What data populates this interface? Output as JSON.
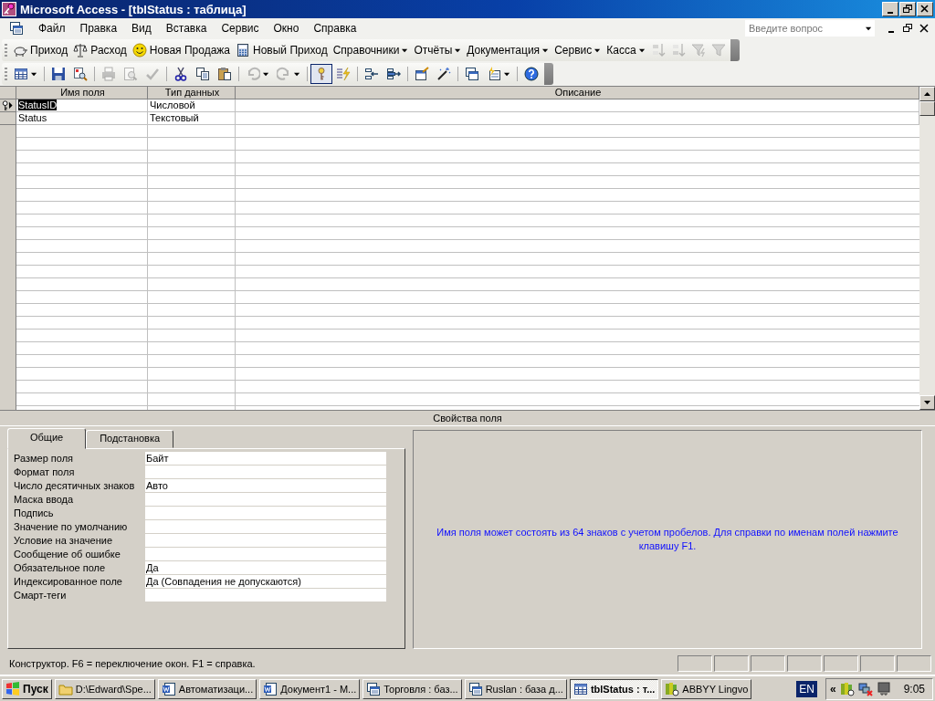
{
  "window": {
    "title": "Microsoft Access - [tblStatus : таблица]"
  },
  "menu": [
    {
      "label": "Файл"
    },
    {
      "label": "Правка"
    },
    {
      "label": "Вид"
    },
    {
      "label": "Вставка"
    },
    {
      "label": "Сервис"
    },
    {
      "label": "Окно"
    },
    {
      "label": "Справка"
    }
  ],
  "help_search": {
    "placeholder": "Введите вопрос"
  },
  "custom_toolbar": [
    {
      "kind": "piggy",
      "label": "Приход",
      "disabled": false
    },
    {
      "kind": "scales",
      "label": "Расход",
      "disabled": false
    },
    {
      "kind": "smiley",
      "label": "Новая Продажа",
      "disabled": false
    },
    {
      "kind": "calculator",
      "label": "Новый Приход",
      "disabled": false
    },
    {
      "kind": "menu",
      "label": "Справочники",
      "disabled": false
    },
    {
      "kind": "menu",
      "label": "Отчёты",
      "disabled": false
    },
    {
      "kind": "menu",
      "label": "Документация",
      "disabled": false
    },
    {
      "kind": "menu",
      "label": "Сервис",
      "disabled": false
    },
    {
      "kind": "menu",
      "label": "Касса",
      "disabled": false
    },
    {
      "kind": "sort_asc",
      "disabled": true
    },
    {
      "kind": "sort_desc",
      "disabled": true
    },
    {
      "kind": "filter_selection",
      "disabled": true
    },
    {
      "kind": "filter",
      "disabled": true
    }
  ],
  "design_toolbar": [
    {
      "kind": "table",
      "dropdown": true,
      "disabled": false,
      "pressed": false
    },
    {
      "kind": "separator"
    },
    {
      "kind": "save",
      "dropdown": false,
      "disabled": false,
      "pressed": false
    },
    {
      "kind": "search_doc",
      "dropdown": false,
      "disabled": false,
      "pressed": false
    },
    {
      "kind": "separator"
    },
    {
      "kind": "print",
      "dropdown": false,
      "disabled": true,
      "pressed": false
    },
    {
      "kind": "preview",
      "dropdown": false,
      "disabled": true,
      "pressed": false
    },
    {
      "kind": "spell",
      "dropdown": false,
      "disabled": true,
      "pressed": false
    },
    {
      "kind": "separator"
    },
    {
      "kind": "cut",
      "dropdown": false,
      "disabled": false,
      "pressed": false
    },
    {
      "kind": "copy",
      "dropdown": false,
      "disabled": false,
      "pressed": false
    },
    {
      "kind": "paste",
      "dropdown": false,
      "disabled": false,
      "pressed": false
    },
    {
      "kind": "separator"
    },
    {
      "kind": "undo",
      "dropdown": true,
      "disabled": true,
      "pressed": false
    },
    {
      "kind": "redo",
      "dropdown": true,
      "disabled": true,
      "pressed": false
    },
    {
      "kind": "separator"
    },
    {
      "kind": "key",
      "dropdown": false,
      "disabled": false,
      "pressed": true
    },
    {
      "kind": "build",
      "dropdown": false,
      "disabled": false,
      "pressed": false
    },
    {
      "kind": "separator"
    },
    {
      "kind": "insert_rows",
      "dropdown": false,
      "disabled": false,
      "pressed": false
    },
    {
      "kind": "delete_rows",
      "dropdown": false,
      "disabled": false,
      "pressed": false
    },
    {
      "kind": "separator"
    },
    {
      "kind": "properties",
      "dropdown": false,
      "disabled": false,
      "pressed": false
    },
    {
      "kind": "builder",
      "dropdown": false,
      "disabled": false,
      "pressed": false
    },
    {
      "kind": "separator"
    },
    {
      "kind": "db_window",
      "dropdown": false,
      "disabled": false,
      "pressed": false
    },
    {
      "kind": "new_object",
      "dropdown": true,
      "disabled": false,
      "pressed": false
    },
    {
      "kind": "separator"
    },
    {
      "kind": "help",
      "dropdown": false,
      "disabled": false,
      "pressed": false
    }
  ],
  "table": {
    "columns": [
      "Имя поля",
      "Тип данных",
      "Описание"
    ],
    "rows": [
      {
        "name": "StatusID",
        "type": "Числовой",
        "selected": true,
        "primary_key": true,
        "current": true
      },
      {
        "name": "Status",
        "type": "Текстовый",
        "selected": false,
        "primary_key": false,
        "current": false
      }
    ]
  },
  "properties": {
    "title": "Свойства поля",
    "tabs": [
      {
        "label": "Общие",
        "selected": true
      },
      {
        "label": "Подстановка",
        "selected": false
      }
    ],
    "items": [
      {
        "label": "Размер поля",
        "value": "Байт"
      },
      {
        "label": "Формат поля"
      },
      {
        "label": "Число десятичных знаков",
        "value": "Авто"
      },
      {
        "label": "Маска ввода"
      },
      {
        "label": "Подпись"
      },
      {
        "label": "Значение по умолчанию"
      },
      {
        "label": "Условие на значение"
      },
      {
        "label": "Сообщение об ошибке"
      },
      {
        "label": "Обязательное поле",
        "value": "Да"
      },
      {
        "label": "Индексированное поле",
        "value": "Да (Совпадения не допускаются)"
      },
      {
        "label": "Смарт-теги"
      }
    ],
    "hint": "Имя поля может состоять из 64 знаков с учетом пробелов.  Для справки по именам полей нажмите клавишу F1."
  },
  "status_bar": {
    "text": "Конструктор.  F6 = переключение окон.  F1 = справка."
  },
  "taskbar": {
    "start": "Пуск",
    "tasks": [
      {
        "kind": "folder",
        "label": "D:\\Edward\\Spe...",
        "selected": false
      },
      {
        "kind": "word",
        "label": "Автоматизаци...",
        "selected": false
      },
      {
        "kind": "word",
        "label": "Документ1 - М...",
        "selected": false
      },
      {
        "kind": "database",
        "label": "Торговля : баз...",
        "selected": false
      },
      {
        "kind": "database",
        "label": "Ruslan : база д...",
        "selected": false
      },
      {
        "kind": "table",
        "label": "tblStatus : т...",
        "selected": true
      },
      {
        "kind": "lingvo",
        "label": "ABBYY Lingvo",
        "selected": false
      }
    ],
    "language": "EN",
    "tray_expand": "«",
    "time": "9:05"
  }
}
